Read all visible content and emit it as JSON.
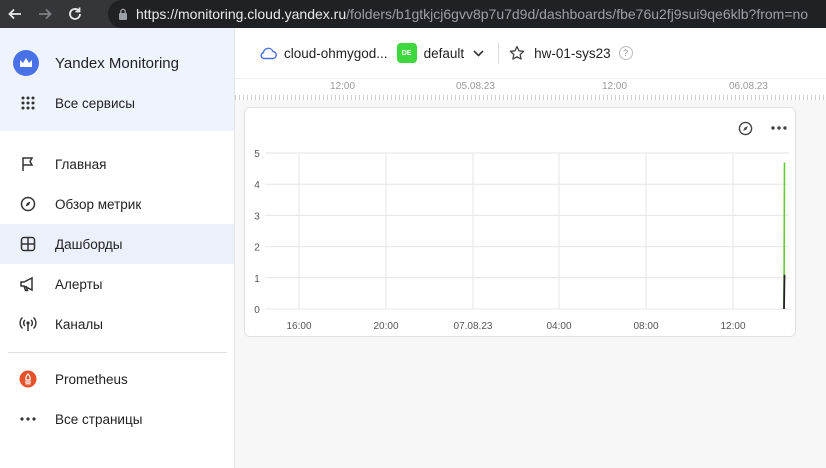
{
  "browser": {
    "url_host": "https://monitoring.cloud.yandex.ru",
    "url_path": "/folders/b1gtkjcj6gvv8p7u7d9d/dashboards/fbe76u2fj9sui9qe6klb?from=no"
  },
  "sidebar": {
    "brand": "Yandex Monitoring",
    "all_services": "Все сервисы",
    "items": [
      {
        "label": "Главная"
      },
      {
        "label": "Обзор метрик"
      },
      {
        "label": "Дашборды"
      },
      {
        "label": "Алерты"
      },
      {
        "label": "Каналы"
      }
    ],
    "prometheus": "Prometheus",
    "all_pages": "Все страницы"
  },
  "topbar": {
    "cloud": "cloud-ohmygod...",
    "env_badge": "DE",
    "folder": "default",
    "dashboard": "hw-01-sys23",
    "help": "?"
  },
  "timeline": {
    "labels": [
      "12:00",
      "05.08.23",
      "12:00",
      "06.08.23"
    ]
  },
  "chart_data": {
    "type": "line",
    "title": "",
    "xlabel": "",
    "ylabel": "",
    "x_ticks": [
      "16:00",
      "20:00",
      "07.08.23",
      "04:00",
      "08:00",
      "12:00"
    ],
    "y_ticks": [
      0,
      1,
      2,
      3,
      4,
      5
    ],
    "ylim": [
      0,
      5
    ],
    "grid": true,
    "series": [
      {
        "color": "#66cc33",
        "x": [
          "14:40",
          "14:40"
        ],
        "values": [
          0,
          4.7
        ]
      },
      {
        "color": "#222222",
        "x": [
          "14:40",
          "14:40"
        ],
        "values": [
          0,
          1.1
        ]
      }
    ]
  },
  "colors": {
    "accent": "#4a72e8",
    "env_badge": "#3ed83e",
    "sidebar_active": "#ebf0fb"
  }
}
